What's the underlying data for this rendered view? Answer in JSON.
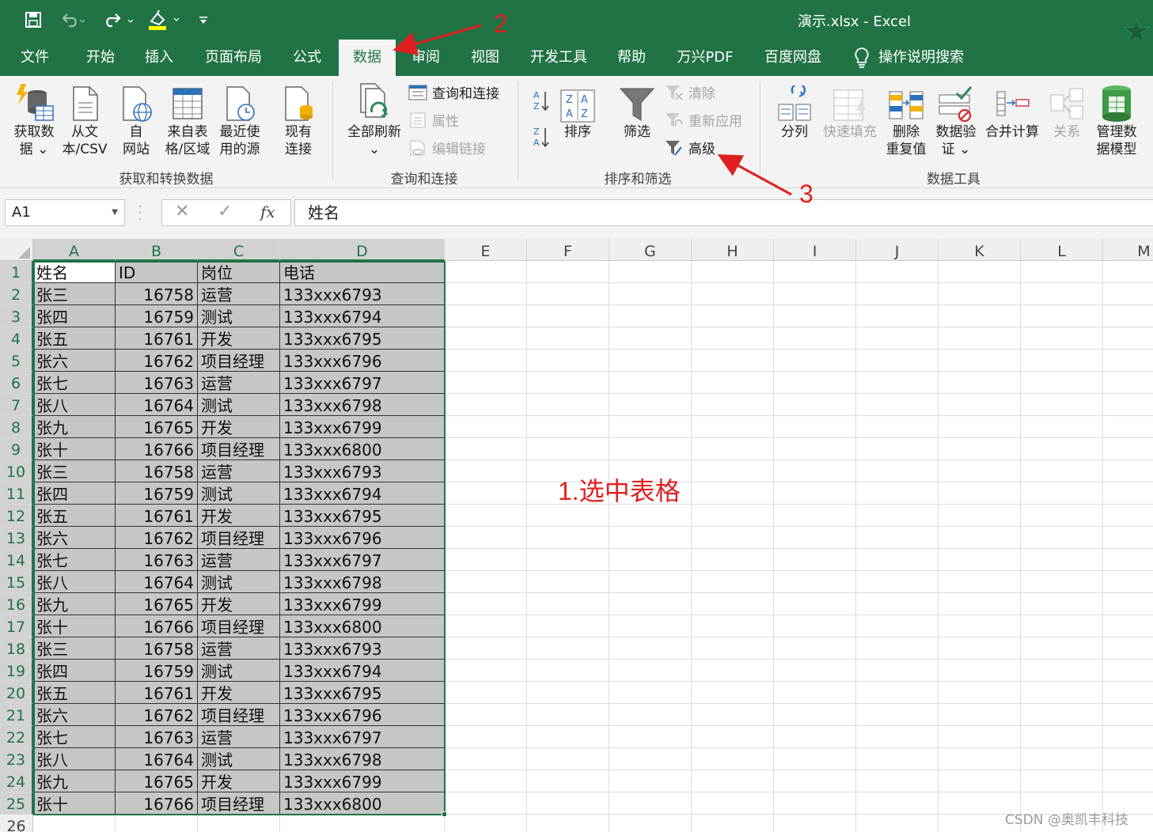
{
  "window": {
    "title": "演示.xlsx  -  Excel"
  },
  "quick_access": [
    "save-icon",
    "undo-icon",
    "redo-icon",
    "format-painter-icon",
    "customize-icon"
  ],
  "tabs": [
    {
      "label": "文件"
    },
    {
      "label": "开始"
    },
    {
      "label": "插入"
    },
    {
      "label": "页面布局"
    },
    {
      "label": "公式"
    },
    {
      "label": "数据",
      "active": true
    },
    {
      "label": "审阅"
    },
    {
      "label": "视图"
    },
    {
      "label": "开发工具"
    },
    {
      "label": "帮助"
    },
    {
      "label": "万兴PDF"
    },
    {
      "label": "百度网盘"
    },
    {
      "label": "操作说明搜索"
    }
  ],
  "ribbon": {
    "groups": [
      {
        "label": "获取和转换数据",
        "buttons": [
          {
            "label": "获取数\n据 ⌄",
            "icon": "get-data-icon"
          },
          {
            "label": "从文\n本/CSV",
            "icon": "from-text-icon"
          },
          {
            "label": "自\n网站",
            "icon": "from-web-icon"
          },
          {
            "label": "来自表\n格/区域",
            "icon": "from-table-icon"
          },
          {
            "label": "最近使\n用的源",
            "icon": "recent-sources-icon"
          },
          {
            "label": "现有\n连接",
            "icon": "existing-connections-icon"
          }
        ]
      },
      {
        "label": "查询和连接",
        "buttons": [
          {
            "label": "全部刷新\n⌄",
            "icon": "refresh-all-icon"
          }
        ],
        "small": [
          {
            "label": "查询和连接",
            "disabled": false
          },
          {
            "label": "属性",
            "disabled": true
          },
          {
            "label": "编辑链接",
            "disabled": true
          }
        ]
      },
      {
        "label": "排序和筛选",
        "buttons": [
          {
            "label": "排序"
          },
          {
            "label": "筛选"
          }
        ],
        "small": [
          {
            "label": "清除",
            "disabled": true
          },
          {
            "label": "重新应用",
            "disabled": true
          },
          {
            "label": "高级",
            "disabled": false
          }
        ]
      },
      {
        "label": "数据工具",
        "buttons": [
          {
            "label": "分列",
            "disabled": false
          },
          {
            "label": "快速填充",
            "disabled": true
          },
          {
            "label": "删除\n重复值",
            "disabled": false
          },
          {
            "label": "数据验\n证 ⌄",
            "disabled": false
          },
          {
            "label": "合并计算",
            "disabled": false
          },
          {
            "label": "关系",
            "disabled": true
          },
          {
            "label": "管理数\n据模型",
            "disabled": false
          }
        ]
      }
    ]
  },
  "formula_bar": {
    "name_box": "A1",
    "formula": "姓名",
    "fx": "fx"
  },
  "sheet": {
    "columns": [
      "A",
      "B",
      "C",
      "D",
      "E",
      "F",
      "G",
      "H",
      "I",
      "J",
      "K",
      "L",
      "M"
    ],
    "headers": [
      "姓名",
      "ID",
      "岗位",
      "电话"
    ],
    "rows": [
      [
        "张三",
        "16758",
        "运营",
        "133xxx6793"
      ],
      [
        "张四",
        "16759",
        "测试",
        "133xxx6794"
      ],
      [
        "张五",
        "16761",
        "开发",
        "133xxx6795"
      ],
      [
        "张六",
        "16762",
        "项目经理",
        "133xxx6796"
      ],
      [
        "张七",
        "16763",
        "运营",
        "133xxx6797"
      ],
      [
        "张八",
        "16764",
        "测试",
        "133xxx6798"
      ],
      [
        "张九",
        "16765",
        "开发",
        "133xxx6799"
      ],
      [
        "张十",
        "16766",
        "项目经理",
        "133xxx6800"
      ],
      [
        "张三",
        "16758",
        "运营",
        "133xxx6793"
      ],
      [
        "张四",
        "16759",
        "测试",
        "133xxx6794"
      ],
      [
        "张五",
        "16761",
        "开发",
        "133xxx6795"
      ],
      [
        "张六",
        "16762",
        "项目经理",
        "133xxx6796"
      ],
      [
        "张七",
        "16763",
        "运营",
        "133xxx6797"
      ],
      [
        "张八",
        "16764",
        "测试",
        "133xxx6798"
      ],
      [
        "张九",
        "16765",
        "开发",
        "133xxx6799"
      ],
      [
        "张十",
        "16766",
        "项目经理",
        "133xxx6800"
      ],
      [
        "张三",
        "16758",
        "运营",
        "133xxx6793"
      ],
      [
        "张四",
        "16759",
        "测试",
        "133xxx6794"
      ],
      [
        "张五",
        "16761",
        "开发",
        "133xxx6795"
      ],
      [
        "张六",
        "16762",
        "项目经理",
        "133xxx6796"
      ],
      [
        "张七",
        "16763",
        "运营",
        "133xxx6797"
      ],
      [
        "张八",
        "16764",
        "测试",
        "133xxx6798"
      ],
      [
        "张九",
        "16765",
        "开发",
        "133xxx6799"
      ],
      [
        "张十",
        "16766",
        "项目经理",
        "133xxx6800"
      ]
    ],
    "extra_row_number": "26"
  },
  "annotations": {
    "step1": "1.选中表格",
    "step2": "2",
    "step3": "3"
  },
  "watermark": "CSDN @奥凯丰科技",
  "colors": {
    "excel_green": "#217346",
    "annotation_red": "#e02020",
    "selection_gray": "#c6c6c6"
  }
}
